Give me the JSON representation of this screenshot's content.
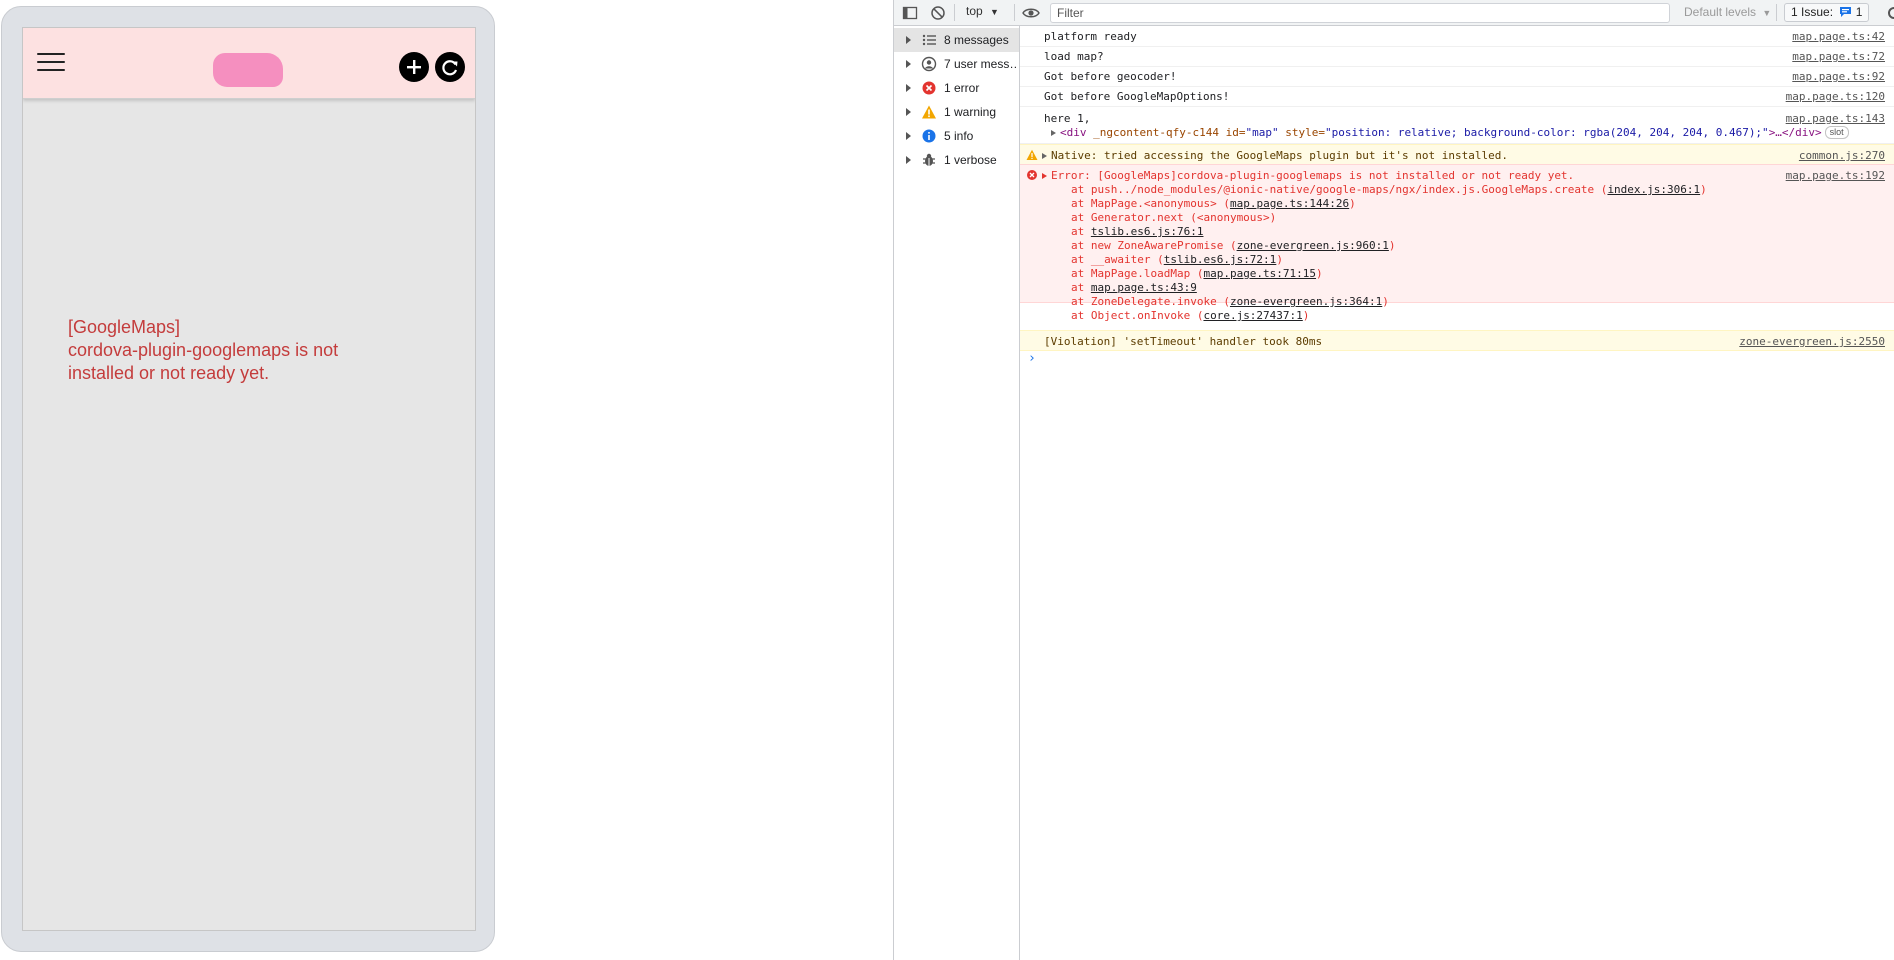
{
  "phone": {
    "map_error_line1": "[GoogleMaps]",
    "map_error_line2": "cordova-plugin-googlemaps is not installed or not ready yet."
  },
  "devtools": {
    "toolbar": {
      "context": "top",
      "filter_placeholder": "Filter",
      "levels": "Default levels",
      "issues_label": "1 Issue:",
      "issues_count": "1"
    },
    "sidebar": [
      {
        "label": "8 messages",
        "icon": "list-icon"
      },
      {
        "label": "7 user mess…",
        "icon": "user-icon"
      },
      {
        "label": "1 error",
        "icon": "error-icon"
      },
      {
        "label": "1 warning",
        "icon": "warning-icon"
      },
      {
        "label": "5 info",
        "icon": "info-icon"
      },
      {
        "label": "1 verbose",
        "icon": "bug-icon"
      }
    ],
    "messages": [
      {
        "text": "platform ready",
        "source": "map.page.ts:42"
      },
      {
        "text": "load map?",
        "source": "map.page.ts:72"
      },
      {
        "text": "Got before geocoder!",
        "source": "map.page.ts:92"
      },
      {
        "text": "Got before GoogleMapOptions!",
        "source": "map.page.ts:120"
      },
      {
        "text": "here 1,",
        "source": "map.page.ts:143",
        "html_tag_open": "<div",
        "html_attr1": "_ngcontent-qfy-c144",
        "html_attr2": "id=",
        "html_attr2_val": "\"map\"",
        "html_attr3": "style=",
        "html_attr3_val": "\"position: relative; background-color: rgba(204, 204, 204, 0.467);\"",
        "html_tag_close": ">…</div>",
        "slot_badge": "slot"
      }
    ],
    "warning": {
      "text": "Native: tried accessing the GoogleMaps plugin but it's not installed.",
      "source": "common.js:270"
    },
    "error": {
      "text": "Error: [GoogleMaps]cordova-plugin-googlemaps is not installed or not ready yet.",
      "source": "map.page.ts:192",
      "stack": [
        {
          "prefix": "at push../node_modules/@ionic-native/google-maps/ngx/index.js.GoogleMaps.create (",
          "link": "index.js:306:1",
          "suffix": ")"
        },
        {
          "prefix": "at MapPage.<anonymous> (",
          "link": "map.page.ts:144:26",
          "suffix": ")"
        },
        {
          "prefix": "at Generator.next (<anonymous>)",
          "link": "",
          "suffix": ""
        },
        {
          "prefix": "at ",
          "link": "tslib.es6.js:76:1",
          "suffix": ""
        },
        {
          "prefix": "at new ZoneAwarePromise (",
          "link": "zone-evergreen.js:960:1",
          "suffix": ")"
        },
        {
          "prefix": "at __awaiter (",
          "link": "tslib.es6.js:72:1",
          "suffix": ")"
        },
        {
          "prefix": "at MapPage.loadMap (",
          "link": "map.page.ts:71:15",
          "suffix": ")"
        },
        {
          "prefix": "at ",
          "link": "map.page.ts:43:9",
          "suffix": ""
        },
        {
          "prefix": "at ZoneDelegate.invoke (",
          "link": "zone-evergreen.js:364:1",
          "suffix": ")"
        },
        {
          "prefix": "at Object.onInvoke (",
          "link": "core.js:27437:1",
          "suffix": ")"
        }
      ]
    },
    "violation": {
      "text": "[Violation] 'setTimeout' handler took 80ms",
      "source": "zone-evergreen.js:2550"
    },
    "prompt": "›"
  },
  "colors": {
    "toolbar_bg": "#fde1e1",
    "logo": "#f58fbf",
    "error_text": "#c43c3c",
    "console_error": "#e3342f",
    "warning_bg": "#fffbe5",
    "error_bg": "#fff0f0"
  }
}
